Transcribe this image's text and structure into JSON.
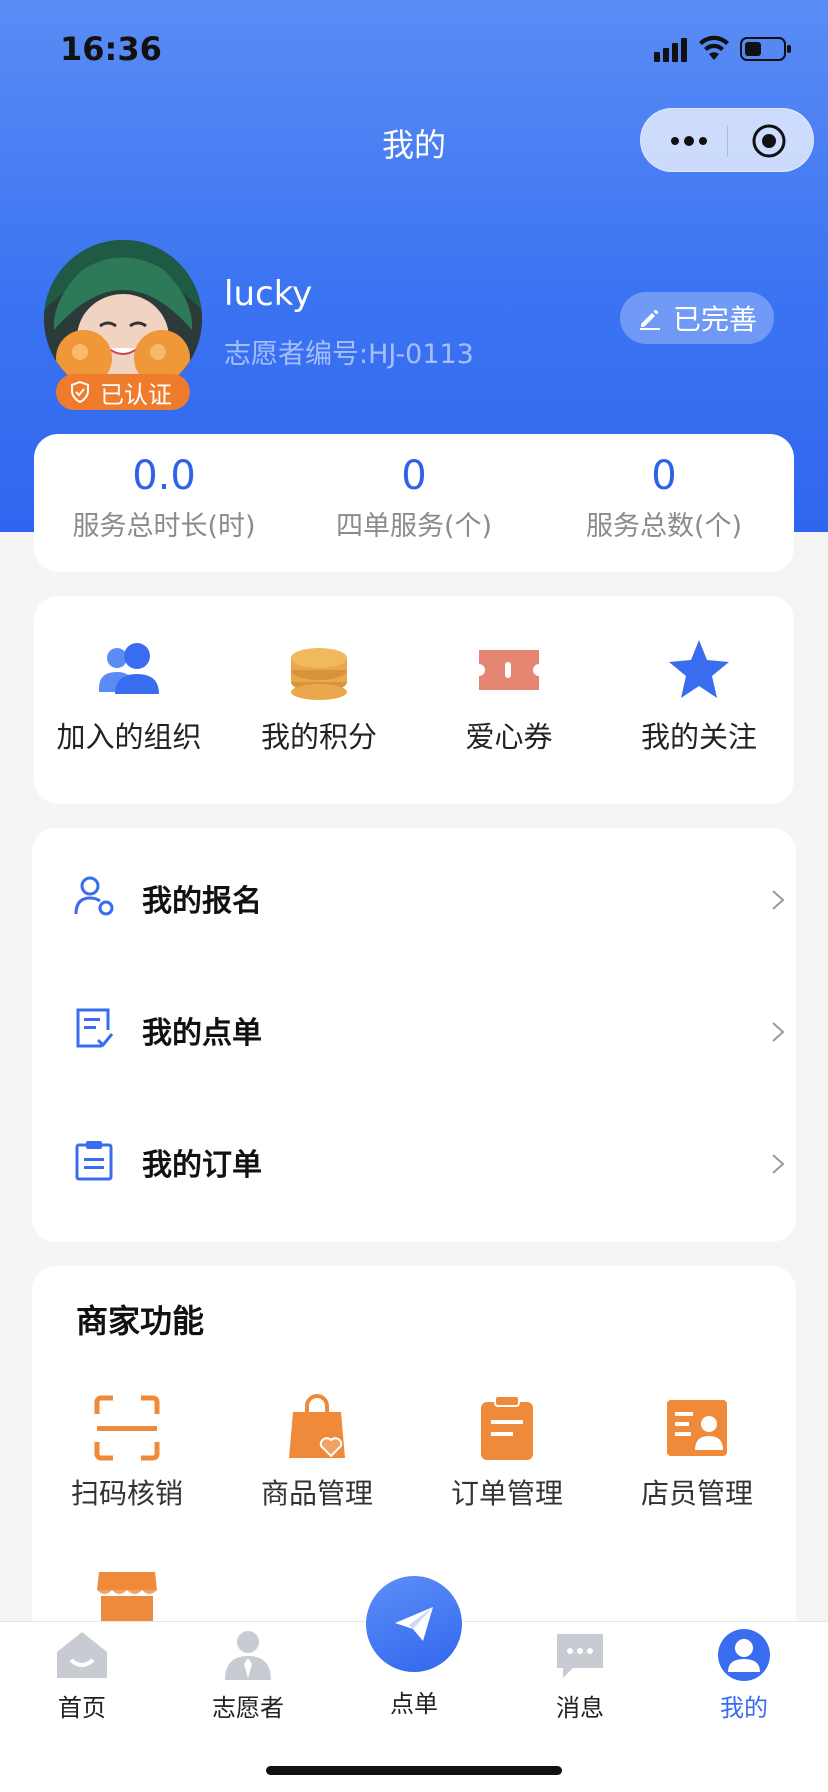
{
  "status_bar": {
    "time": "16:36"
  },
  "nav": {
    "title": "我的"
  },
  "profile": {
    "username": "lucky",
    "volunteer_id": "志愿者编号:HJ-0113",
    "verified_badge": "已认证",
    "completed_button": "已完善"
  },
  "stats": [
    {
      "value": "0.0",
      "label": "服务总时长(时)"
    },
    {
      "value": "0",
      "label": "四单服务(个)"
    },
    {
      "value": "0",
      "label": "服务总数(个)"
    }
  ],
  "quick": [
    {
      "label": "加入的组织",
      "icon": "organization-icon"
    },
    {
      "label": "我的积分",
      "icon": "coins-icon"
    },
    {
      "label": "爱心券",
      "icon": "coupon-icon"
    },
    {
      "label": "我的关注",
      "icon": "star-icon"
    }
  ],
  "list": [
    {
      "label": "我的报名",
      "icon": "user-register-icon"
    },
    {
      "label": "我的点单",
      "icon": "checklist-icon"
    },
    {
      "label": "我的订单",
      "icon": "clipboard-icon"
    }
  ],
  "merchant": {
    "title": "商家功能",
    "items": [
      {
        "label": "扫码核销",
        "icon": "scan-icon"
      },
      {
        "label": "商品管理",
        "icon": "shopping-bag-icon"
      },
      {
        "label": "订单管理",
        "icon": "order-icon"
      },
      {
        "label": "店员管理",
        "icon": "staff-card-icon"
      }
    ]
  },
  "tabbar": [
    {
      "label": "首页",
      "icon": "home-icon"
    },
    {
      "label": "志愿者",
      "icon": "volunteer-icon"
    },
    {
      "label": "点单",
      "icon": "paper-plane-icon"
    },
    {
      "label": "消息",
      "icon": "message-icon"
    },
    {
      "label": "我的",
      "icon": "profile-icon"
    }
  ],
  "colors": {
    "primary": "#3a6cf0",
    "accent_orange": "#ef8a3a",
    "coupon": "#e58672",
    "coin": "#e9a84c"
  }
}
